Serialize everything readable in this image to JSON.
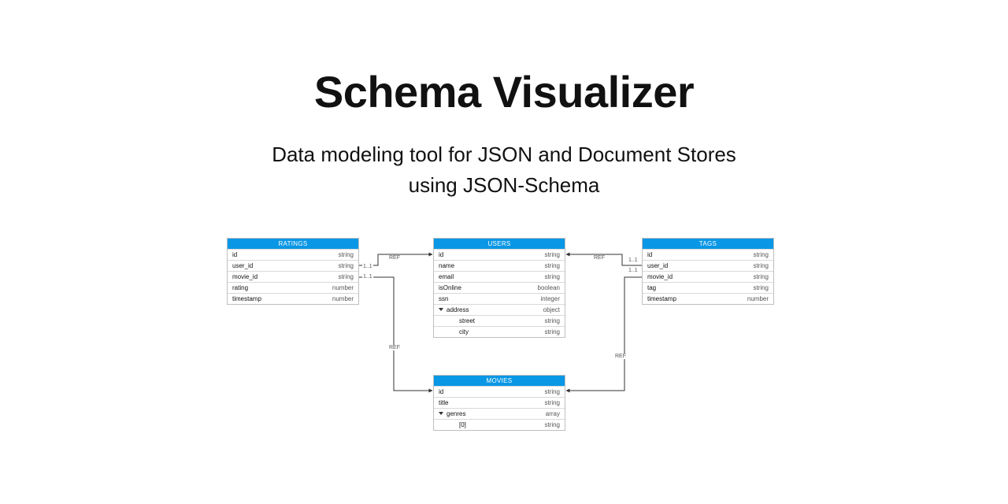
{
  "header": {
    "title": "Schema Visualizer",
    "subtitle_l1": "Data modeling tool for JSON and Document Stores",
    "subtitle_l2": "using JSON-Schema"
  },
  "edge_labels": {
    "ref": "REF",
    "card": "1..1"
  },
  "tables": {
    "ratings": {
      "name": "RATINGS",
      "rows": [
        {
          "field": "id",
          "type": "string"
        },
        {
          "field": "user_id",
          "type": "string"
        },
        {
          "field": "movie_id",
          "type": "string"
        },
        {
          "field": "rating",
          "type": "number"
        },
        {
          "field": "timestamp",
          "type": "number"
        }
      ]
    },
    "users": {
      "name": "USERS",
      "rows": [
        {
          "field": "id",
          "type": "string"
        },
        {
          "field": "name",
          "type": "string"
        },
        {
          "field": "email",
          "type": "string"
        },
        {
          "field": "isOnline",
          "type": "boolean"
        },
        {
          "field": "ssn",
          "type": "integer"
        },
        {
          "field": "address",
          "type": "object",
          "expandable": true
        },
        {
          "field": "street",
          "type": "string",
          "indent": 2
        },
        {
          "field": "city",
          "type": "string",
          "indent": 2
        }
      ]
    },
    "tags": {
      "name": "TAGS",
      "rows": [
        {
          "field": "id",
          "type": "string"
        },
        {
          "field": "user_id",
          "type": "string"
        },
        {
          "field": "movie_id",
          "type": "string"
        },
        {
          "field": "tag",
          "type": "string"
        },
        {
          "field": "timestamp",
          "type": "number"
        }
      ]
    },
    "movies": {
      "name": "MOVIES",
      "rows": [
        {
          "field": "id",
          "type": "string"
        },
        {
          "field": "title",
          "type": "string"
        },
        {
          "field": "genres",
          "type": "array",
          "expandable": true
        },
        {
          "field": "[0]",
          "type": "string",
          "indent": 2
        }
      ]
    }
  }
}
